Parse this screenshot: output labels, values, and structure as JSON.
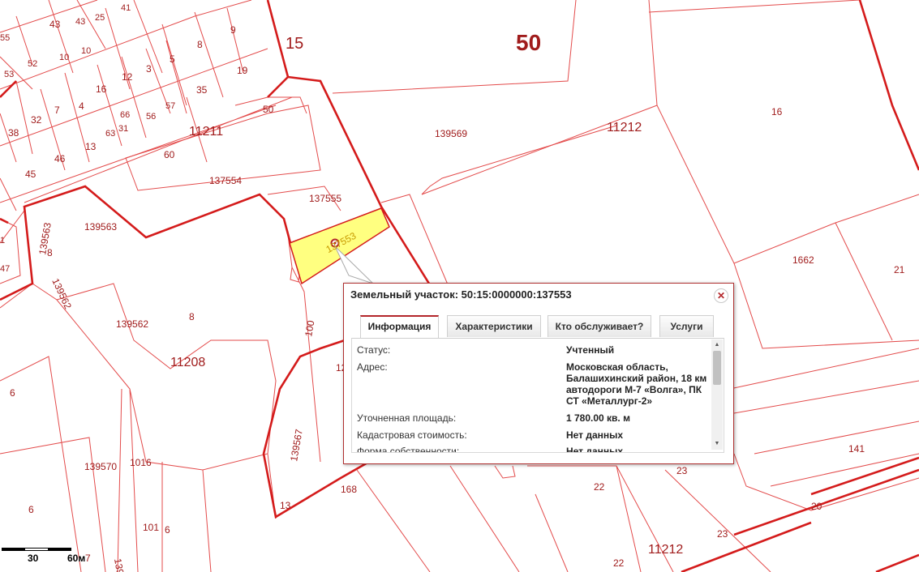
{
  "map": {
    "labels": {
      "l15": "15",
      "l50": "50",
      "l11212a": "11212",
      "l16": "16",
      "l139569": "139569",
      "l11211": "11211",
      "l137554": "137554",
      "l137555": "137555",
      "l137553": "137553",
      "l139563": "139563",
      "l139562": "139562",
      "l11208": "11208",
      "l8a": "8",
      "l8b": "8",
      "l1662": "1662",
      "l21": "21",
      "l141": "141",
      "l20": "20",
      "l23a": "23",
      "l23b": "23",
      "l22a": "22",
      "l22b": "22",
      "l11212b": "11212",
      "l168": "168",
      "l139567": "139567",
      "l139570a": "139570",
      "l101a": "101",
      "l6a": "6",
      "l101b": "101",
      "l6b": "6",
      "l139570b": "139570",
      "l6c": "6",
      "l6d": "6",
      "l13": "13",
      "l100": "100",
      "l139563v": "139563",
      "l139562v": "139562",
      "l60": "60",
      "l50s": "50",
      "l35": "35",
      "l19": "19",
      "l9": "9",
      "l8c": "8",
      "l5": "5",
      "l3": "3",
      "l12": "12",
      "l16s": "16",
      "l4": "4",
      "l7": "7",
      "l32": "32",
      "l38": "38",
      "l45": "45",
      "l46": "46",
      "l13s": "13",
      "l63": "63",
      "l31": "31",
      "l56": "56",
      "l57": "57",
      "l66": "66",
      "l43a": "43",
      "l43b": "43",
      "l25": "25",
      "l41": "41",
      "l10a": "10",
      "l10b": "10",
      "l52": "52",
      "l53": "53",
      "l55": "55",
      "l47": "47",
      "l1": "1",
      "l12b": "12"
    }
  },
  "scale": {
    "label_30": "30",
    "label_60": "60м",
    "label_7": "7"
  },
  "popup": {
    "title": "Земельный участок: 50:15:0000000:137553",
    "close_icon": "✕",
    "tabs": [
      "Информация",
      "Характеристики",
      "Кто обслуживает?",
      "Услуги"
    ],
    "rows": [
      {
        "key": "Статус:",
        "value": "Учтенный"
      },
      {
        "key": "Адрес:",
        "value": "Московская область, Балашихинский район, 18 км автодороги М-7 «Волга», ПК СТ «Металлург-2»"
      },
      {
        "key": "Уточненная площадь:",
        "value": "1 780.00 кв. м"
      },
      {
        "key": "Кадастровая стоимость:",
        "value": "Нет данных"
      },
      {
        "key": "Форма собственности:",
        "value": "Нет данных"
      }
    ]
  },
  "colors": {
    "boundary": "#d41b1b",
    "parcel_thin": "#e34b4b",
    "selected_fill": "#ffff80",
    "label": "#a01c1c"
  }
}
